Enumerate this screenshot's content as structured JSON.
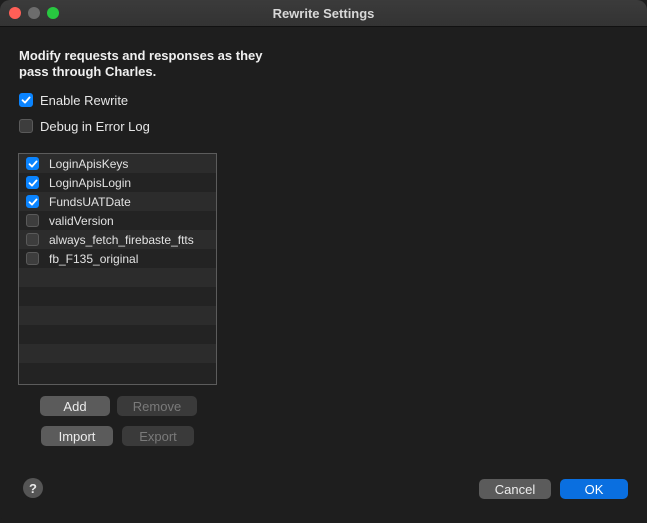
{
  "window": {
    "title": "Rewrite Settings"
  },
  "description": "Modify requests and responses as they pass through Charles.",
  "options": [
    {
      "label": "Enable Rewrite",
      "checked": true
    },
    {
      "label": "Debug in Error Log",
      "checked": false
    }
  ],
  "rules": [
    {
      "label": "LoginApisKeys",
      "checked": true
    },
    {
      "label": "LoginApisLogin",
      "checked": true
    },
    {
      "label": "FundsUATDate",
      "checked": true
    },
    {
      "label": "validVersion",
      "checked": false
    },
    {
      "label": "always_fetch_firebaste_ftts",
      "checked": false
    },
    {
      "label": "fb_F135_original",
      "checked": false
    },
    {
      "label": "",
      "checked": null
    },
    {
      "label": "",
      "checked": null
    },
    {
      "label": "",
      "checked": null
    },
    {
      "label": "",
      "checked": null
    },
    {
      "label": "",
      "checked": null
    },
    {
      "label": "",
      "checked": null
    }
  ],
  "list_buttons": {
    "add": "Add",
    "remove": "Remove",
    "import": "Import",
    "export": "Export"
  },
  "footer": {
    "help": "?",
    "cancel": "Cancel",
    "ok": "OK"
  },
  "colors": {
    "accent": "#0a84ff",
    "close": "#ff5f57",
    "zoom": "#28c840"
  }
}
